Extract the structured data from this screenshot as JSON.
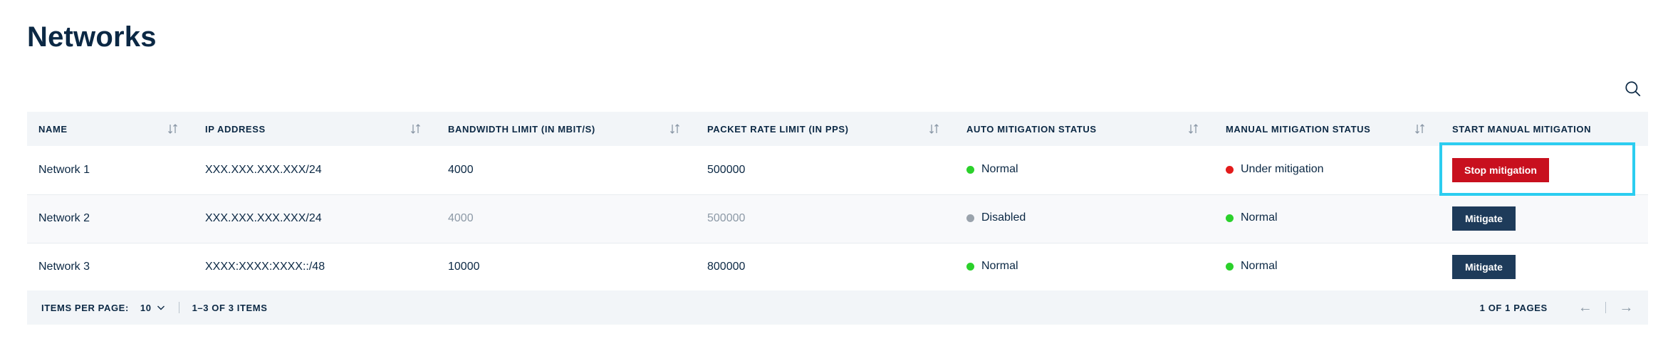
{
  "page": {
    "title": "Networks"
  },
  "colors": {
    "normal": "#2bd12b",
    "alert": "#e31b1b",
    "disabled": "#9aa3ac",
    "stop": "#c8101e",
    "mitigate": "#1e3b5a",
    "focus": "#2ccdf0"
  },
  "table": {
    "headers": {
      "name": "NAME",
      "ip": "IP ADDRESS",
      "bandwidth": "BANDWIDTH LIMIT (IN MBIT/S)",
      "packet": "PACKET RATE LIMIT (IN PPS)",
      "auto": "AUTO MITIGATION STATUS",
      "manual": "MANUAL MITIGATION STATUS",
      "start": "START MANUAL MITIGATION"
    },
    "rows": [
      {
        "name": "Network 1",
        "ip": "XXX.XXX.XXX.XXX/24",
        "bandwidth": "4000",
        "packet": "500000",
        "auto": "Normal",
        "manual": "Under mitigation",
        "action": "Stop mitigation"
      },
      {
        "name": "Network 2",
        "ip": "XXX.XXX.XXX.XXX/24",
        "bandwidth": "4000",
        "packet": "500000",
        "auto": "Disabled",
        "manual": "Normal",
        "action": "Mitigate"
      },
      {
        "name": "Network 3",
        "ip": "XXXX:XXXX:XXXX::/48",
        "bandwidth": "10000",
        "packet": "800000",
        "auto": "Normal",
        "manual": "Normal",
        "action": "Mitigate"
      }
    ]
  },
  "pager": {
    "items_per_page_label": "ITEMS PER PAGE:",
    "items_per_page_value": "10",
    "range": "1–3 OF 3 ITEMS",
    "pages": "1 OF 1 PAGES"
  }
}
